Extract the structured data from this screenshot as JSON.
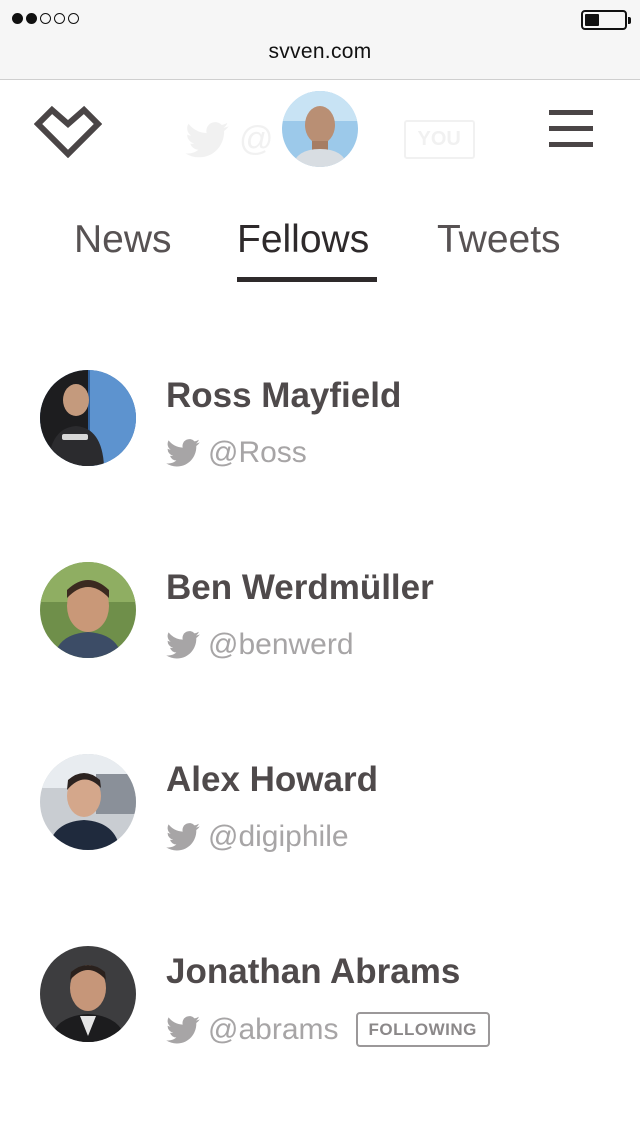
{
  "browser": {
    "url": "svven.com",
    "signal_bars_filled": 2,
    "signal_bars_total": 5,
    "battery_level": 0.3
  },
  "header": {
    "ghost_handle": "@",
    "ghost_badge": "YOU"
  },
  "tabs": [
    {
      "label": "News",
      "active": false
    },
    {
      "label": "Fellows",
      "active": true
    },
    {
      "label": "Tweets",
      "active": false
    }
  ],
  "fellows": [
    {
      "name": "Ross Mayfield",
      "handle": "@Ross",
      "badge": ""
    },
    {
      "name": "Ben Werdmüller",
      "handle": "@benwerd",
      "badge": ""
    },
    {
      "name": "Alex Howard",
      "handle": "@digiphile",
      "badge": ""
    },
    {
      "name": "Jonathan Abrams",
      "handle": "@abrams",
      "badge": "FOLLOWING"
    }
  ],
  "colors": {
    "text_dark": "#2e2a2b",
    "text_name": "#4f4a4b",
    "text_muted": "#a7a5a6",
    "twitter_icon": "#a7a5a6"
  },
  "icons": {
    "logo": "heart-chevron-icon",
    "menu": "hamburger-menu-icon",
    "twitter": "twitter-bird-icon"
  }
}
